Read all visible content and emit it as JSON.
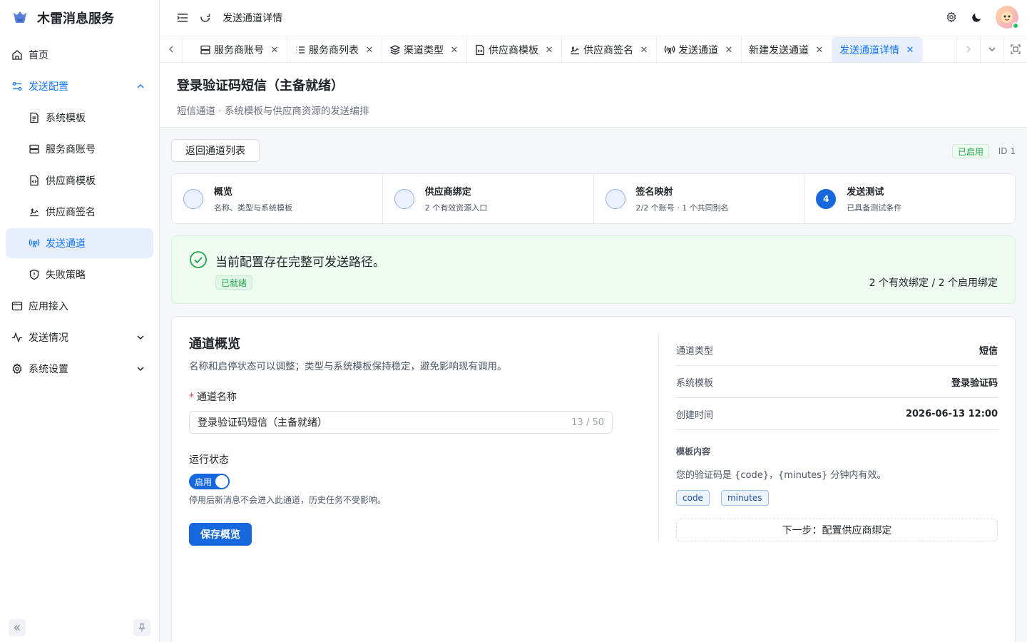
{
  "app": {
    "name": "木雷消息服务"
  },
  "sidebar": {
    "items": [
      {
        "label": "首页"
      },
      {
        "label": "发送配置"
      },
      {
        "label": "系统模板"
      },
      {
        "label": "服务商账号"
      },
      {
        "label": "供应商模板"
      },
      {
        "label": "供应商签名"
      },
      {
        "label": "发送通道"
      },
      {
        "label": "失败策略"
      },
      {
        "label": "应用接入"
      },
      {
        "label": "发送情况"
      },
      {
        "label": "系统设置"
      }
    ]
  },
  "header": {
    "title": "发送通道详情"
  },
  "tabs": [
    {
      "label": "服务商账号"
    },
    {
      "label": "服务商列表"
    },
    {
      "label": "渠道类型"
    },
    {
      "label": "供应商模板"
    },
    {
      "label": "供应商签名"
    },
    {
      "label": "发送通道"
    },
    {
      "label": "新建发送通道"
    },
    {
      "label": "发送通道详情"
    }
  ],
  "page": {
    "title": "登录验证码短信（主备就绪）",
    "subtitle": "短信通道 · 系统模板与供应商资源的发送编排"
  },
  "toolbar": {
    "back_label": "返回通道列表",
    "status_tag": "已启用",
    "id_label": "ID 1"
  },
  "steps": [
    {
      "title": "概览",
      "desc": "名称、类型与系统模板",
      "num": ""
    },
    {
      "title": "供应商绑定",
      "desc": "2 个有效资源入口",
      "num": ""
    },
    {
      "title": "签名映射",
      "desc": "2/2 个账号 · 1 个共同别名",
      "num": ""
    },
    {
      "title": "发送测试",
      "desc": "已具备测试条件",
      "num": "4"
    }
  ],
  "alert": {
    "message": "当前配置存在完整可发送路径。",
    "tag": "已就绪",
    "summary": "2 个有效绑定 / 2 个启用绑定"
  },
  "overview": {
    "title": "通道概览",
    "desc": "名称和启停状态可以调整；类型与系统模板保持稳定，避免影响现有调用。",
    "name_label": "通道名称",
    "name_value": "登录验证码短信（主备就绪）",
    "name_count": "13 / 50",
    "status_label": "运行状态",
    "toggle_label": "启用",
    "hint": "停用后新消息不会进入此通道，历史任务不受影响。",
    "save_label": "保存概览"
  },
  "details": {
    "rows": [
      {
        "key": "通道类型",
        "value": "短信"
      },
      {
        "key": "系统模板",
        "value": "登录验证码"
      },
      {
        "key": "创建时间",
        "value": "2026-06-13 12:00"
      }
    ],
    "template_label": "模板内容",
    "template_content": "您的验证码是 {code}，{minutes} 分钟内有效。",
    "variables": [
      "code",
      "minutes"
    ],
    "next_step": "下一步：配置供应商绑定"
  },
  "colors": {
    "primary": "#1668dc",
    "success": "#22a34a",
    "active_bg": "#e6effb"
  }
}
